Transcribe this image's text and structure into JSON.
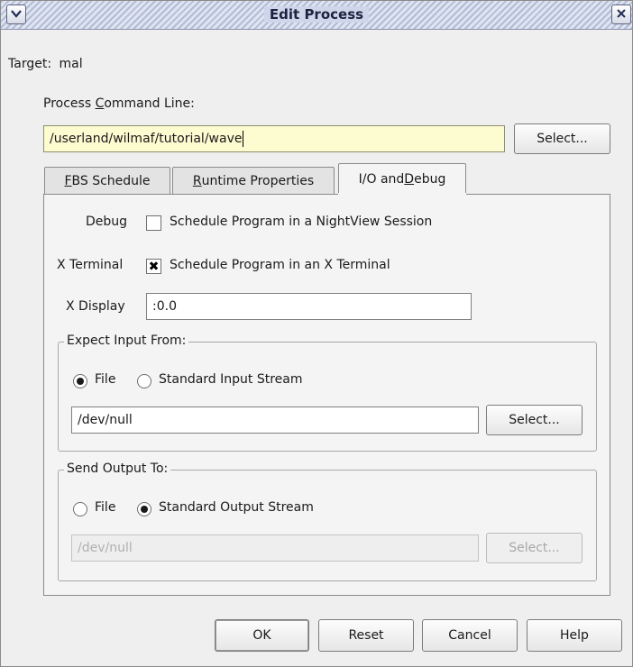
{
  "window": {
    "title": "Edit Process",
    "menu_icon": "chevron-down-icon",
    "close_icon": "close-icon"
  },
  "target": {
    "label": "Target:",
    "value": "mal"
  },
  "command_line": {
    "label_pre": "Process ",
    "label_mnemonic": "C",
    "label_post": "ommand Line:",
    "value": "/userland/wilmaf/tutorial/wave",
    "select_label": "Select..."
  },
  "tabs": [
    {
      "mnemonic": "F",
      "rest": "BS Schedule"
    },
    {
      "mnemonic": "R",
      "rest": "untime Properties"
    },
    {
      "pre": "I/O and ",
      "mnemonic": "D",
      "rest": "ebug"
    }
  ],
  "debug": {
    "label": "Debug",
    "checkbox_label": "Schedule Program in a NightView Session",
    "checked": false
  },
  "xterminal": {
    "label": "X Terminal",
    "checkbox_label": "Schedule Program in an X Terminal",
    "checked": true,
    "check_mark": "✖"
  },
  "xdisplay": {
    "label": "X Display",
    "value": ":0.0"
  },
  "input_group": {
    "legend": "Expect Input From:",
    "option_file": "File",
    "option_stream": "Standard Input Stream",
    "selected": "file",
    "path": "/dev/null",
    "select_label": "Select..."
  },
  "output_group": {
    "legend": "Send Output To:",
    "option_file": "File",
    "option_stream": "Standard Output Stream",
    "selected": "stream",
    "path": "/dev/null",
    "select_label": "Select..."
  },
  "footer": {
    "ok": "OK",
    "reset": "Reset",
    "cancel": "Cancel",
    "help": "Help"
  }
}
